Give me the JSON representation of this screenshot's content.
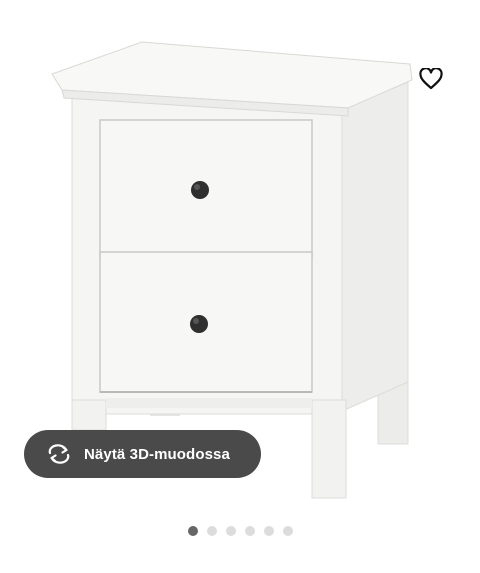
{
  "product": {
    "image_subject": "white two-drawer bedside chest",
    "favourite_icon": "heart-outline-icon"
  },
  "view3d": {
    "label": "Näytä 3D-muodossa",
    "icon": "rotate-arrows-icon"
  },
  "carousel": {
    "total_images": 6,
    "active_index": 0
  },
  "colors": {
    "button_bg": "#4a4a4a",
    "dot_active": "#666666",
    "dot_inactive": "#dcdcdc"
  }
}
